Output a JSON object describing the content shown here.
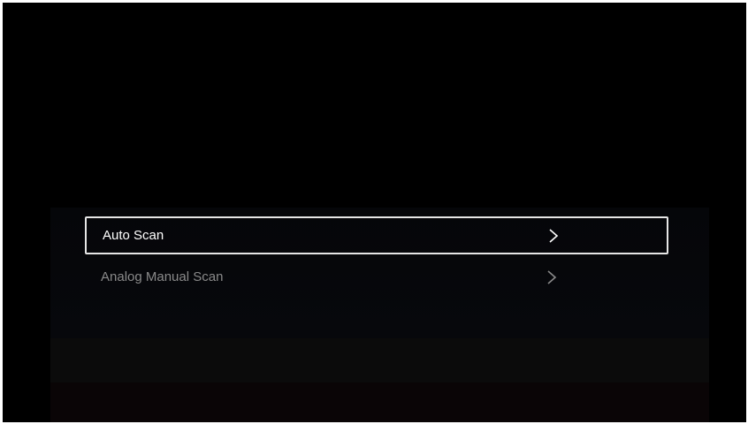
{
  "menu": {
    "items": [
      {
        "label": "Auto Scan",
        "icon": "chevron-right-icon",
        "selected": true
      },
      {
        "label": "Analog Manual Scan",
        "icon": "chevron-right-icon",
        "selected": false
      }
    ]
  },
  "colors": {
    "background": "#000000",
    "selected_text": "#ffffff",
    "selected_border": "#e6e6e6",
    "normal_text": "#8a8a8a"
  }
}
